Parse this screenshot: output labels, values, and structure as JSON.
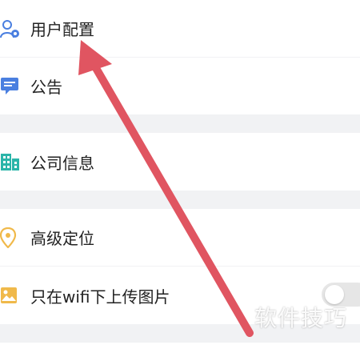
{
  "menu": {
    "user_config": "用户配置",
    "notice": "公告",
    "company_info": "公司信息",
    "location": "高级定位",
    "wifi_upload": "只在wifi下上传图片"
  },
  "watermark": "软件技巧",
  "icons": {
    "user_config": "user-settings-icon",
    "notice": "message-icon",
    "company_info": "building-icon",
    "location": "location-pin-icon",
    "wifi_upload": "image-icon"
  },
  "colors": {
    "background": "#f1f2f4",
    "row": "#ffffff",
    "blue_icon": "#4a7fe0",
    "teal_icon": "#2bb5a9",
    "yellow_icon": "#f0b94a",
    "arrow": "#e05561"
  },
  "wifi_toggle_on": false
}
